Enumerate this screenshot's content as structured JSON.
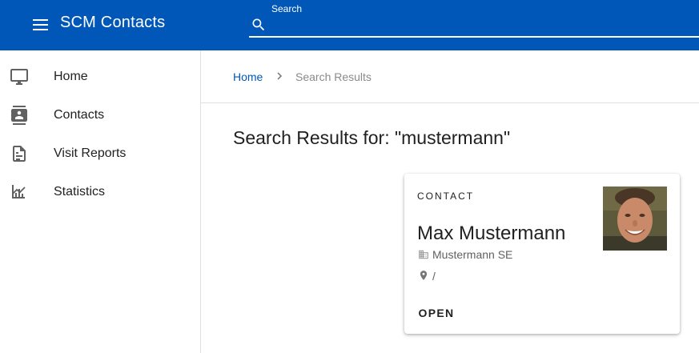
{
  "app": {
    "title": "SCM Contacts",
    "brand_color": "#0057b8"
  },
  "search": {
    "label": "Search",
    "value": "",
    "placeholder": ""
  },
  "sidebar": {
    "items": [
      {
        "label": "Home",
        "icon": "monitor-icon"
      },
      {
        "label": "Contacts",
        "icon": "contacts-icon"
      },
      {
        "label": "Visit Reports",
        "icon": "document-icon"
      },
      {
        "label": "Statistics",
        "icon": "statistics-icon"
      }
    ]
  },
  "breadcrumb": {
    "home": "Home",
    "current": "Search Results"
  },
  "main": {
    "title": "Search Results for: \"mustermann\""
  },
  "card": {
    "overline": "CONTACT",
    "name": "Max Mustermann",
    "company": "Mustermann SE",
    "location": "/",
    "action": "OPEN"
  }
}
